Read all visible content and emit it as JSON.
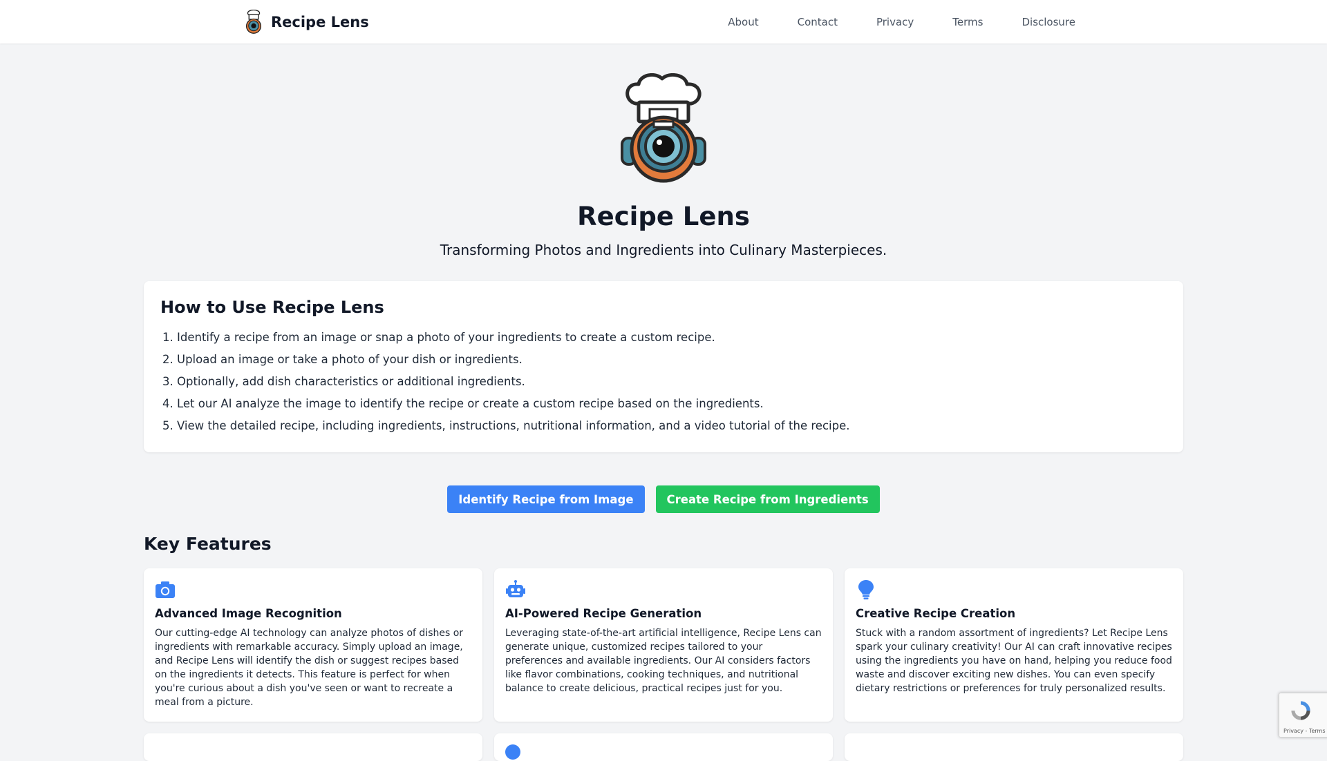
{
  "header": {
    "brand": "Recipe Lens",
    "nav": [
      "About",
      "Contact",
      "Privacy",
      "Terms",
      "Disclosure"
    ]
  },
  "hero": {
    "title": "Recipe Lens",
    "subtitle": "Transforming Photos and Ingredients into Culinary Masterpieces."
  },
  "howto": {
    "title": "How to Use Recipe Lens",
    "steps": [
      "Identify a recipe from an image or snap a photo of your ingredients to create a custom recipe.",
      "Upload an image or take a photo of your dish or ingredients.",
      "Optionally, add dish characteristics or additional ingredients.",
      "Let our AI analyze the image to identify the recipe or create a custom recipe based on the ingredients.",
      "View the detailed recipe, including ingredients, instructions, nutritional information, and a video tutorial of the recipe."
    ]
  },
  "ctas": {
    "identify": "Identify Recipe from Image",
    "create": "Create Recipe from Ingredients"
  },
  "features": {
    "title": "Key Features",
    "items": [
      {
        "icon": "camera-icon",
        "title": "Advanced Image Recognition",
        "text": "Our cutting-edge AI technology can analyze photos of dishes or ingredients with remarkable accuracy. Simply upload an image, and Recipe Lens will identify the dish or suggest recipes based on the ingredients it detects. This feature is perfect for when you're curious about a dish you've seen or want to recreate a meal from a picture."
      },
      {
        "icon": "robot-icon",
        "title": "AI-Powered Recipe Generation",
        "text": "Leveraging state-of-the-art artificial intelligence, Recipe Lens can generate unique, customized recipes tailored to your preferences and available ingredients. Our AI considers factors like flavor combinations, cooking techniques, and nutritional balance to create delicious, practical recipes just for you."
      },
      {
        "icon": "lightbulb-icon",
        "title": "Creative Recipe Creation",
        "text": "Stuck with a random assortment of ingredients? Let Recipe Lens spark your culinary creativity! Our AI can craft innovative recipes using the ingredients you have on hand, helping you reduce food waste and discover exciting new dishes. You can even specify dietary restrictions or preferences for truly personalized results."
      }
    ]
  },
  "recaptcha": {
    "links": "Privacy - Terms"
  },
  "colors": {
    "blue": "#3b82f6",
    "green": "#22c55e",
    "background": "#f3f4f6"
  }
}
